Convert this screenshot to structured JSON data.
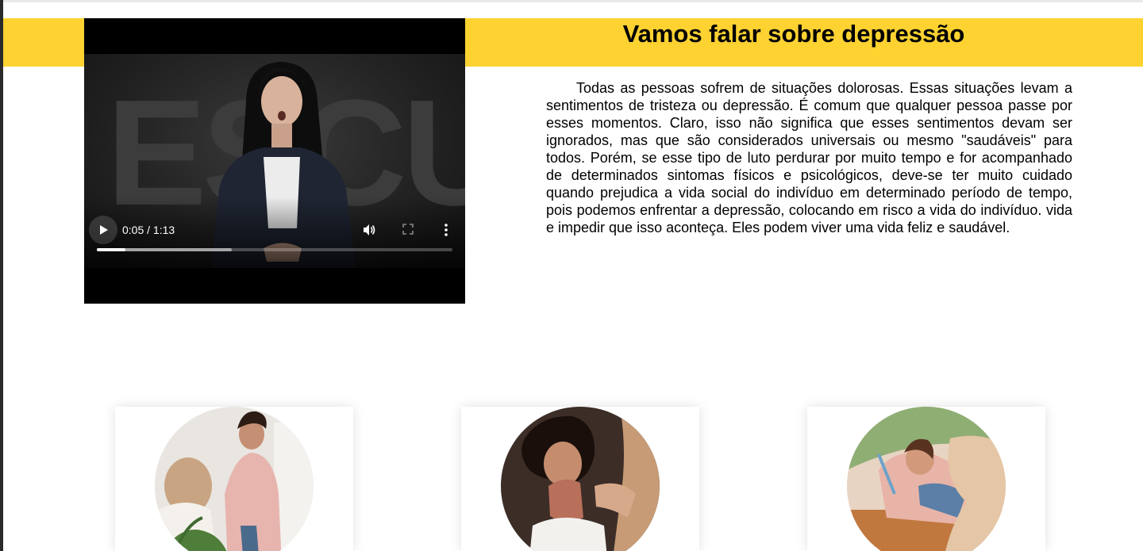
{
  "section": {
    "title": "Vamos falar sobre depressão",
    "paragraph": "Todas as pessoas sofrem de situações dolorosas. Essas situações levam a sentimentos de tristeza ou depressão. É comum que qualquer pessoa passe por esses momentos. Claro, isso não significa que esses sentimentos devam ser ignorados, mas que são considerados universais ou mesmo \"saudáveis\" para todos. Porém, se esse tipo de luto perdurar por muito tempo e for acompanhado de determinados sintomas físicos e psicológicos, deve-se ter muito cuidado quando prejudica a vida social do indivíduo em determinado período de tempo, pois podemos enfrentar a depressão, colocando em risco a vida do indivíduo. vida e impedir que isso aconteça. Eles podem viver uma vida feliz e saudável."
  },
  "video": {
    "background_text": "ESCUTE",
    "current_time": "0:05",
    "duration": "1:13",
    "time_display": "0:05 / 1:13",
    "played_fraction": 0.08,
    "buffered_fraction": 0.38,
    "icons": [
      "play-icon",
      "volume-icon",
      "fullscreen-icon",
      "more-options-icon"
    ]
  },
  "cards": [
    {
      "icon": "photo-consoling-crying-woman"
    },
    {
      "icon": "photo-woman-crying-hands"
    },
    {
      "icon": "photo-therapy-session"
    }
  ],
  "colors": {
    "banner": "#fdd231",
    "text": "#000000",
    "video_background": "#000000"
  }
}
